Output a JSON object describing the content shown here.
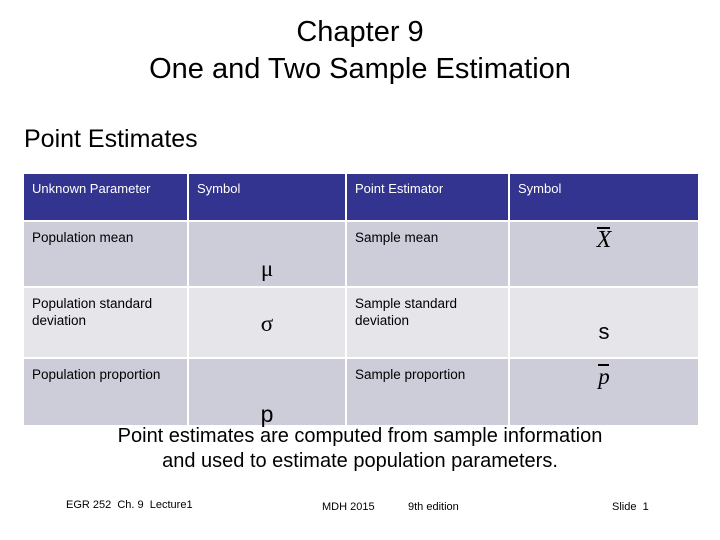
{
  "slide": {
    "title_line1": "Chapter 9",
    "title_line2": "One and Two Sample Estimation",
    "section_heading": "Point Estimates",
    "caption_line1": "Point estimates are computed from sample information",
    "caption_line2": "and used to estimate population parameters."
  },
  "table": {
    "headers": [
      "Unknown Parameter",
      "Symbol",
      "Point Estimator",
      "Symbol"
    ],
    "rows": [
      {
        "parameter": "Population mean",
        "parameter_symbol": "μ",
        "estimator": "Sample mean",
        "estimator_symbol": "X"
      },
      {
        "parameter": "Population standard deviation",
        "parameter_symbol": "σ",
        "estimator": "Sample standard deviation",
        "estimator_symbol": "s"
      },
      {
        "parameter": "Population proportion",
        "parameter_symbol": "p",
        "estimator": "Sample proportion",
        "estimator_symbol": "p"
      }
    ]
  },
  "footer": {
    "course": "EGR 252  Ch. 9  Lecture1",
    "author": "MDH 2015",
    "edition": "9th edition",
    "slide_number": "Slide  1"
  },
  "colors": {
    "header_blue": "#333390",
    "row_dark": "#cdcdda",
    "row_light": "#e5e5ea",
    "text": "#000000",
    "background": "#ffffff"
  }
}
